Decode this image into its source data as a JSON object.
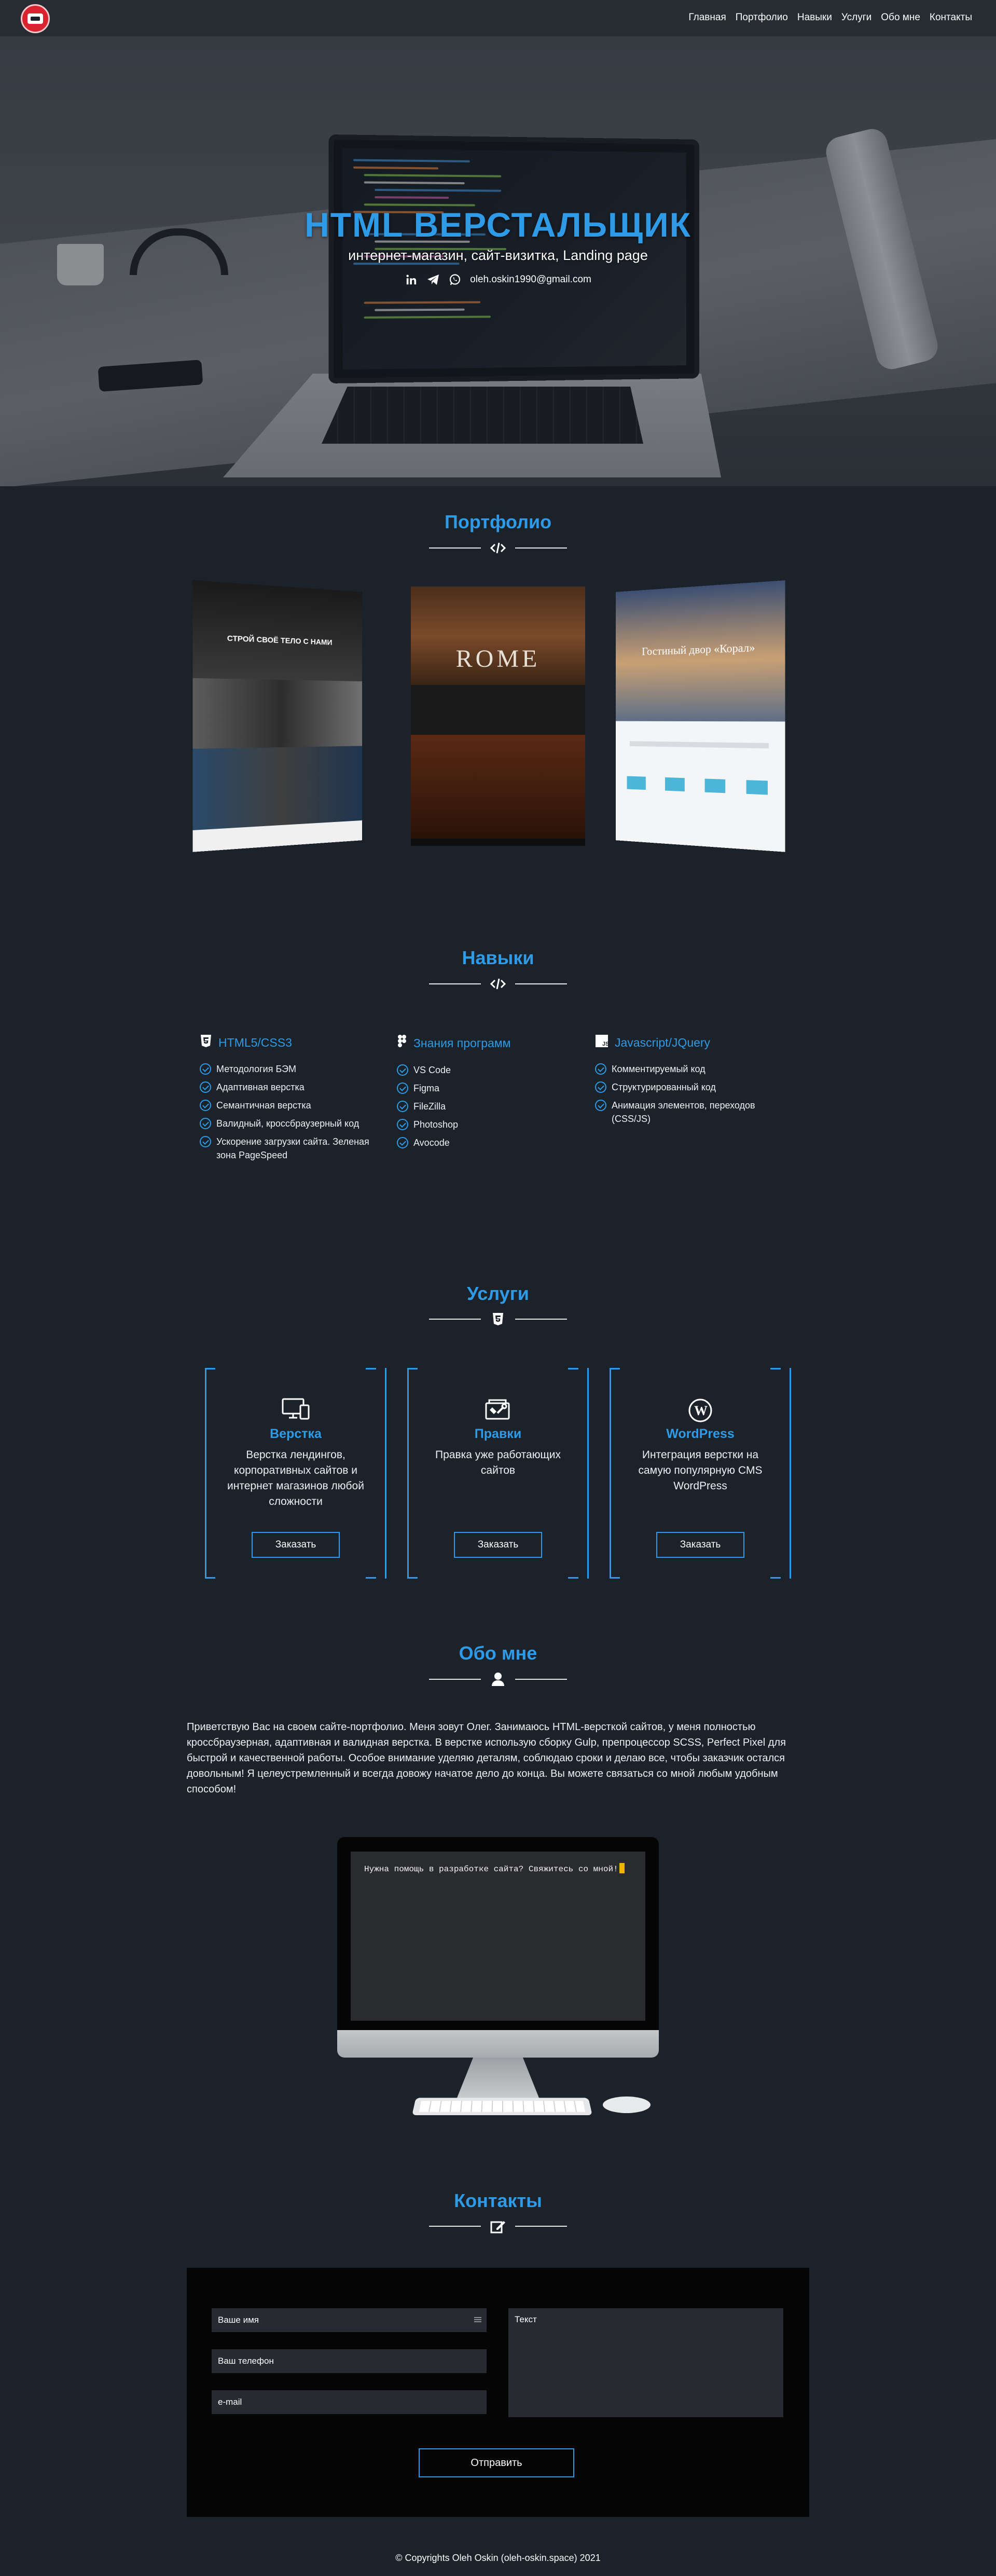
{
  "nav": {
    "items": [
      "Главная",
      "Портфолио",
      "Навыки",
      "Услуги",
      "Обо мне",
      "Контакты"
    ]
  },
  "hero": {
    "title": "HTML ВЕРСТАЛЬЩИК",
    "subtitle": "интернет-магазин, сайт-визитка, Landing page",
    "email": "oleh.oskin1990@gmail.com",
    "icons": [
      "linkedin-icon",
      "telegram-icon",
      "whatsapp-icon"
    ]
  },
  "portfolio": {
    "title": "Портфолио",
    "divider_icon": "code-icon",
    "projects": [
      {
        "headline": "СТРОЙ СВОЁ ТЕЛО С НАМИ"
      },
      {
        "headline": "ROME"
      },
      {
        "headline": "Гостиный двор «Корал»"
      }
    ]
  },
  "skills": {
    "title": "Навыки",
    "divider_icon": "code-icon",
    "columns": [
      {
        "title": "HTML5/CSS3",
        "icon": "css3-icon",
        "items": [
          "Методология БЭМ",
          "Адаптивная верстка",
          "Семантичная верстка",
          "Валидный, кроссбраузерный код",
          "Ускорение загрузки сайта. Зеленая зона PageSpeed"
        ]
      },
      {
        "title": "Знания программ",
        "icon": "figma-icon",
        "items": [
          "VS Code",
          "Figma",
          "FileZilla",
          "Photoshop",
          "Avocode"
        ]
      },
      {
        "title": "Javascript/JQuery",
        "icon": "js-icon",
        "items": [
          "Комментируемый код",
          "Структурированный код",
          "Анимация элементов, переходов (CSS/JS)"
        ]
      }
    ]
  },
  "services": {
    "title": "Услуги",
    "divider_icon": "html5-icon",
    "cards": [
      {
        "name": "Верстка",
        "icon": "devices-icon",
        "desc": "Верстка лендингов, корпоративных сайтов и интернет магазинов любой сложности",
        "button": "Заказать"
      },
      {
        "name": "Правки",
        "icon": "tools-icon",
        "desc": "Правка уже работающих сайтов",
        "button": "Заказать"
      },
      {
        "name": "WordPress",
        "icon": "wordpress-icon",
        "desc": "Интеграция верстки на самую популярную CMS WordPress",
        "button": "Заказать"
      }
    ]
  },
  "about": {
    "title": "Обо мне",
    "divider_icon": "user-icon",
    "text": "Приветствую Вас на своем сайте-портфолио. Меня зовут Олег. Занимаюсь HTML-версткой сайтов, у меня полностью кроссбраузерная, адаптивная и валидная верстка. В верстке использую сборку Gulp, препроцессор SCSS, Perfect Pixel для быстрой и качественной работы. Особое внимание уделяю деталям, соблюдаю сроки и делаю все, чтобы заказчик остался довольным! Я целеустремленный и всегда довожу начатое дело до конца. Вы можете связаться со мной любым удобным способом!",
    "monitor_text": "Нужна помощь в разработке сайта? Свяжитесь со мной!"
  },
  "contacts": {
    "title": "Контакты",
    "divider_icon": "edit-icon",
    "name_placeholder": "Ваше имя",
    "phone_placeholder": "Ваш телефон",
    "email_placeholder": "e-mail",
    "text_placeholder": "Текст",
    "submit": "Отправить"
  },
  "footer": {
    "copyright": "© Copyrights Oleh Oskin (oleh-oskin.space) 2021"
  },
  "colors": {
    "accent": "#2f9be6",
    "background": "#1b222a",
    "contact_box": "#050505"
  }
}
